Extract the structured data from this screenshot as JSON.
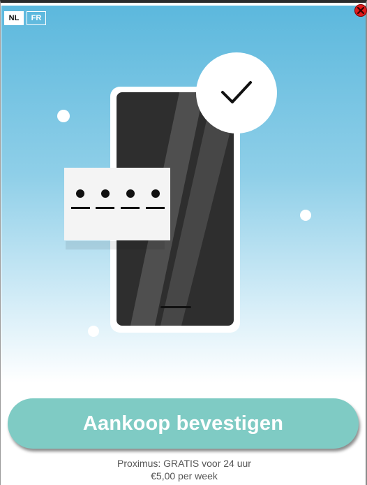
{
  "language_switcher": {
    "nl_label": "NL",
    "fr_label": "FR",
    "active": "NL"
  },
  "close": {
    "icon": "close-icon",
    "color": "#e11b1b"
  },
  "illustration": {
    "phone_icon": "smartphone-icon",
    "pin_dots": 4,
    "check_icon": "checkmark-icon"
  },
  "cta": {
    "label": "Aankoop bevestigen",
    "color": "#7fcbc4"
  },
  "pricing": {
    "line1": "Proximus: GRATIS voor 24 uur",
    "line2": "€5,00 per week"
  },
  "colors": {
    "sky_top": "#5cb8dd",
    "phone": "#2b2b2b"
  }
}
